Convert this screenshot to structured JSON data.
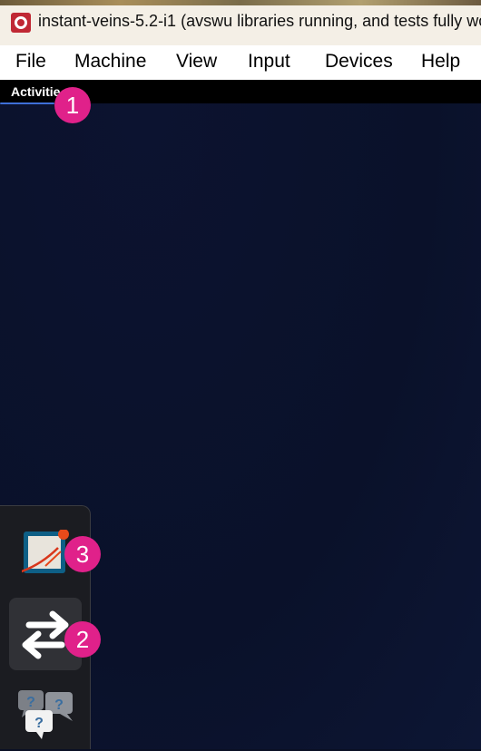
{
  "window": {
    "title": "instant-veins-5.2-i1 (avswu libraries running, and tests fully wo"
  },
  "menu": {
    "items": [
      "File",
      "Machine",
      "View",
      "Input",
      "Devices",
      "Help"
    ]
  },
  "topbar": {
    "activities_label": "Activitie"
  },
  "dock": {
    "apps": [
      {
        "icon": "text-editor-icon"
      },
      {
        "icon": "transfer-arrows-icon"
      },
      {
        "icon": "help-chat-icon"
      }
    ]
  },
  "callouts": [
    "1",
    "2",
    "3"
  ],
  "colors": {
    "callout": "#e0218a",
    "notification_dot": "#e84a1a",
    "desktop": "#0a1024"
  }
}
